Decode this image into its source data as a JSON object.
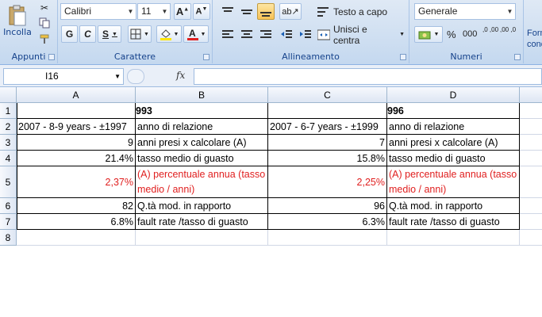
{
  "ribbon": {
    "clipboard": {
      "paste_label": "Incolla",
      "group_label": "Appunti"
    },
    "font": {
      "name": "Calibri",
      "size": "11",
      "bold": "G",
      "italic": "C",
      "underline": "S",
      "group_label": "Carattere"
    },
    "alignment": {
      "wrap_text": "Testo a capo",
      "merge_center": "Unisci e centra",
      "group_label": "Allineamento"
    },
    "number": {
      "format": "Generale",
      "percent": "%",
      "thousands": "000",
      "inc_decimal": ",0 ,00",
      "dec_decimal": ",00 ,0",
      "group_label": "Numeri"
    },
    "styles_partial": {
      "line1": "Form",
      "line2": "cond"
    }
  },
  "formula_bar": {
    "name_box": "I16",
    "fx": "fx",
    "content": ""
  },
  "columns": [
    "A",
    "B",
    "C",
    "D"
  ],
  "rows": [
    "1",
    "2",
    "3",
    "4",
    "5",
    "6",
    "7",
    "8"
  ],
  "cells": {
    "B1": "993",
    "D1": "996",
    "A2": "2007 - 8-9 years - ±1997",
    "B2": "anno di relazione",
    "C2": "2007 - 6-7 years - ±1999",
    "D2": "anno di relazione",
    "A3": "9",
    "B3": "anni presi x calcolare (A)",
    "C3": "7",
    "D3": "anni presi x calcolare (A)",
    "A4": "21.4%",
    "B4": "tasso medio di guasto",
    "C4": "15.8%",
    "D4": "tasso medio di guasto",
    "A5": "2,37%",
    "B5": "(A) percentuale annua (tasso medio / anni)",
    "C5": "2,25%",
    "D5": "(A) percentuale annua (tasso medio / anni)",
    "A6": "82",
    "B6": "Q.tà mod. in rapporto",
    "C6": "96",
    "D6": "Q.tà mod. in rapporto",
    "A7": "6.8%",
    "B7": "fault rate /tasso di guasto",
    "C7": "6.3%",
    "D7": "fault rate /tasso di guasto"
  },
  "colors": {
    "red_text": "#e01f1f",
    "ribbon_bg": "#dfe9f5",
    "font_color_bar": "#e02020",
    "fill_color_bar": "#ffe600"
  }
}
